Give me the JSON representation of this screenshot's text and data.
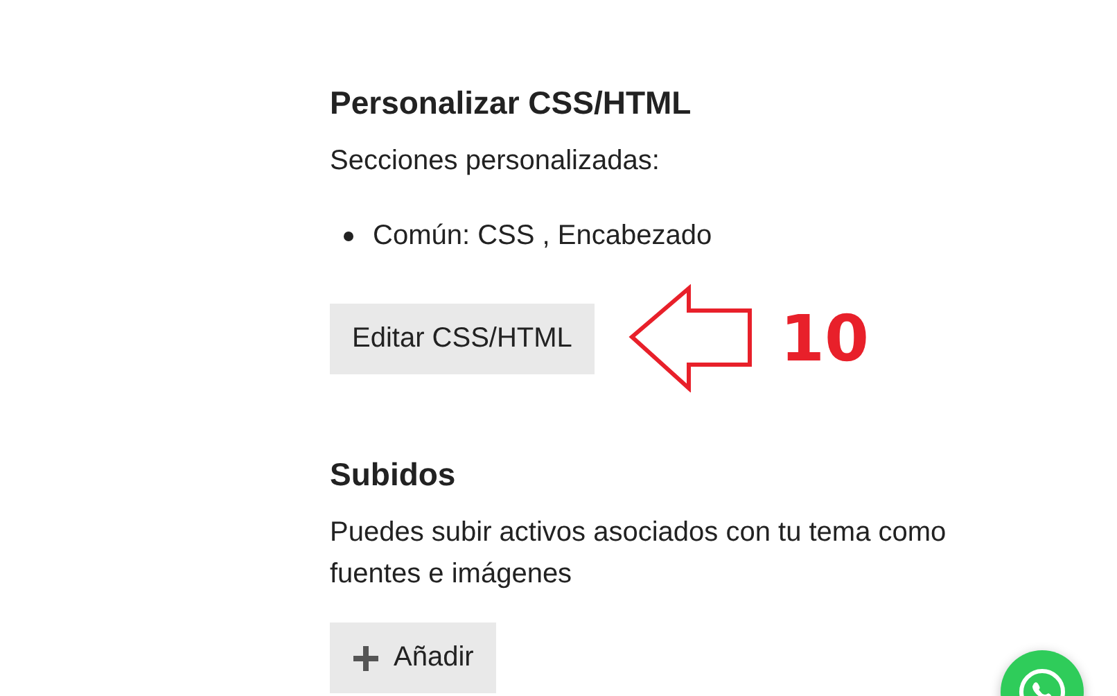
{
  "sections": [
    {
      "heading": "Personalizar CSS/HTML",
      "text": "Secciones personalizadas:",
      "items": [
        "Común: CSS , Encabezado"
      ],
      "button": {
        "label": "Editar CSS/HTML",
        "kind": "text"
      }
    },
    {
      "heading": "Subidos",
      "text": "Puedes subir activos asociados con tu tema como fuentes e imágenes",
      "button": {
        "label": "Añadir",
        "kind": "add"
      }
    }
  ],
  "annotation": {
    "label": "10"
  }
}
